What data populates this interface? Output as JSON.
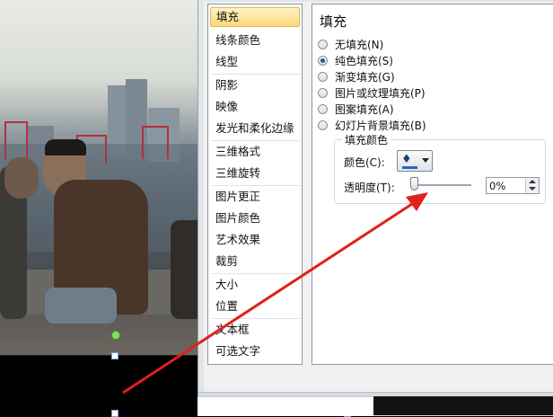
{
  "categories": [
    {
      "label": "填充",
      "selected": true
    },
    {
      "label": "线条颜色"
    },
    {
      "label": "线型"
    },
    {
      "label": "阴影"
    },
    {
      "label": "映像"
    },
    {
      "label": "发光和柔化边缘"
    },
    {
      "label": "三维格式"
    },
    {
      "label": "三维旋转"
    },
    {
      "label": "图片更正"
    },
    {
      "label": "图片颜色"
    },
    {
      "label": "艺术效果"
    },
    {
      "label": "裁剪"
    },
    {
      "label": "大小"
    },
    {
      "label": "位置"
    },
    {
      "label": "文本框"
    },
    {
      "label": "可选文字"
    }
  ],
  "content": {
    "title": "填充",
    "fill_options": [
      {
        "label": "无填充(N)",
        "checked": false
      },
      {
        "label": "纯色填充(S)",
        "checked": true
      },
      {
        "label": "渐变填充(G)",
        "checked": false
      },
      {
        "label": "图片或纹理填充(P)",
        "checked": false
      },
      {
        "label": "图案填充(A)",
        "checked": false
      },
      {
        "label": "幻灯片背景填充(B)",
        "checked": false
      }
    ],
    "fill_color_group": {
      "title": "填充颜色",
      "color_label": "颜色(C):",
      "color_icon": "paint-bucket-icon",
      "selected_color": "#2f63b8",
      "transparency_label": "透明度(T):",
      "transparency_value": "0%",
      "transparency_fraction": 0.0
    }
  },
  "annotation": {
    "arrow_color": "#e0201c"
  }
}
